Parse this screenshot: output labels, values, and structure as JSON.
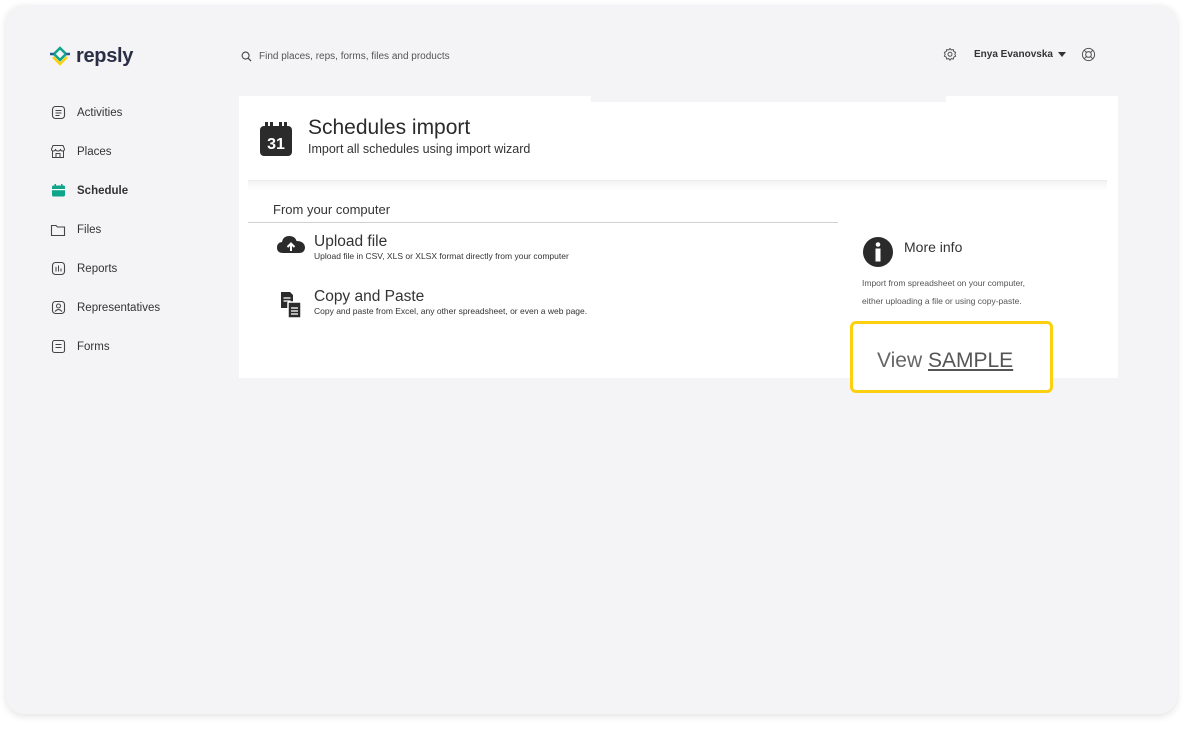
{
  "brand": {
    "name": "repsly",
    "colors": {
      "accent": "#0ea58a",
      "highlight": "#fcd00f"
    }
  },
  "search": {
    "placeholder": "Find places, reps, forms, files and products",
    "icon": "search-icon"
  },
  "header": {
    "user_name": "Enya Evanovska",
    "settings_icon": "gear-icon",
    "help_icon": "lifebuoy-icon"
  },
  "sidebar": {
    "items": [
      {
        "label": "Activities",
        "icon": "clipboard-icon",
        "active": false
      },
      {
        "label": "Places",
        "icon": "store-icon",
        "active": false
      },
      {
        "label": "Schedule",
        "icon": "calendar-icon",
        "active": true
      },
      {
        "label": "Files",
        "icon": "folder-icon",
        "active": false
      },
      {
        "label": "Reports",
        "icon": "report-icon",
        "active": false
      },
      {
        "label": "Representatives",
        "icon": "user-card-icon",
        "active": false
      },
      {
        "label": "Forms",
        "icon": "form-icon",
        "active": false
      }
    ]
  },
  "page": {
    "icon_day": "31",
    "title": "Schedules import",
    "subtitle": "Import all schedules using import wizard"
  },
  "section": {
    "title": "From your computer"
  },
  "options": [
    {
      "title": "Upload file",
      "description": "Upload file in CSV, XLS or XLSX format directly from your computer",
      "icon": "cloud-upload-icon"
    },
    {
      "title": "Copy and Paste",
      "description": "Copy and paste from Excel, any other spreadsheet, or even a web page.",
      "icon": "copy-paste-icon"
    }
  ],
  "info": {
    "title": "More info",
    "line1": "Import from spreadsheet on your computer,",
    "line2": "either uploading a file or using copy-paste."
  },
  "sample": {
    "prefix": "View",
    "link": "SAMPLE"
  }
}
